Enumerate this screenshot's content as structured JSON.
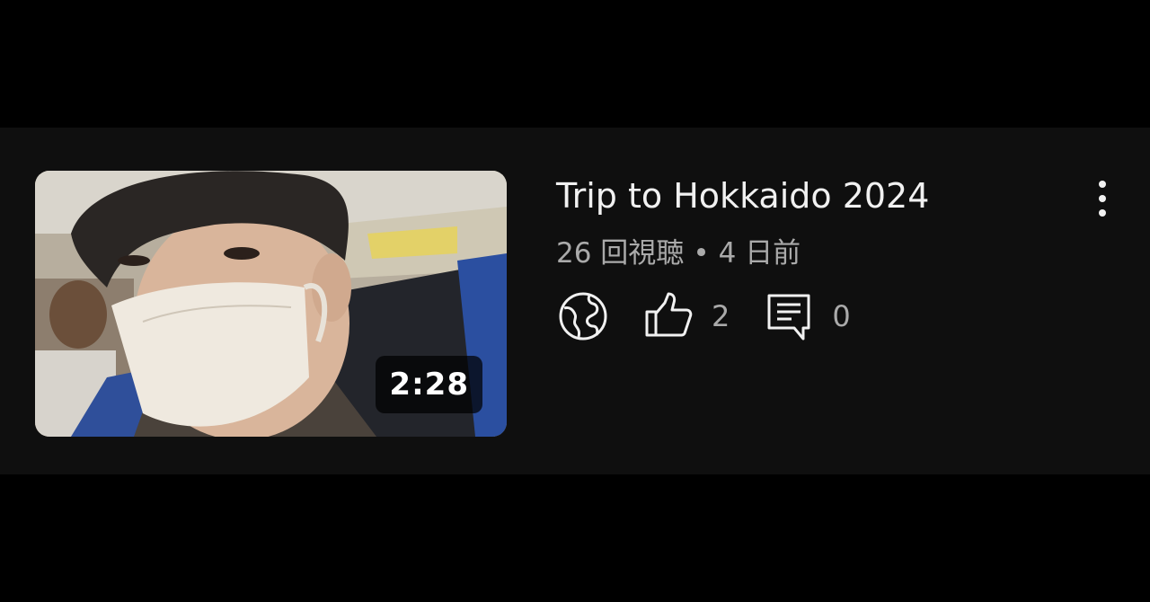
{
  "video": {
    "duration": "2:28",
    "title": "Trip to Hokkaido 2024",
    "views": "26 回視聴",
    "separator": "•",
    "age": "4 日前",
    "visibility_icon": "globe-icon",
    "like_icon": "thumb-up-icon",
    "like_count": "2",
    "comment_icon": "comment-icon",
    "comment_count": "0",
    "menu_icon": "more-vert-icon"
  },
  "colors": {
    "background": "#000000",
    "card": "#0f0f0f",
    "title": "#f1f1f1",
    "secondary": "#aaaaaa"
  }
}
